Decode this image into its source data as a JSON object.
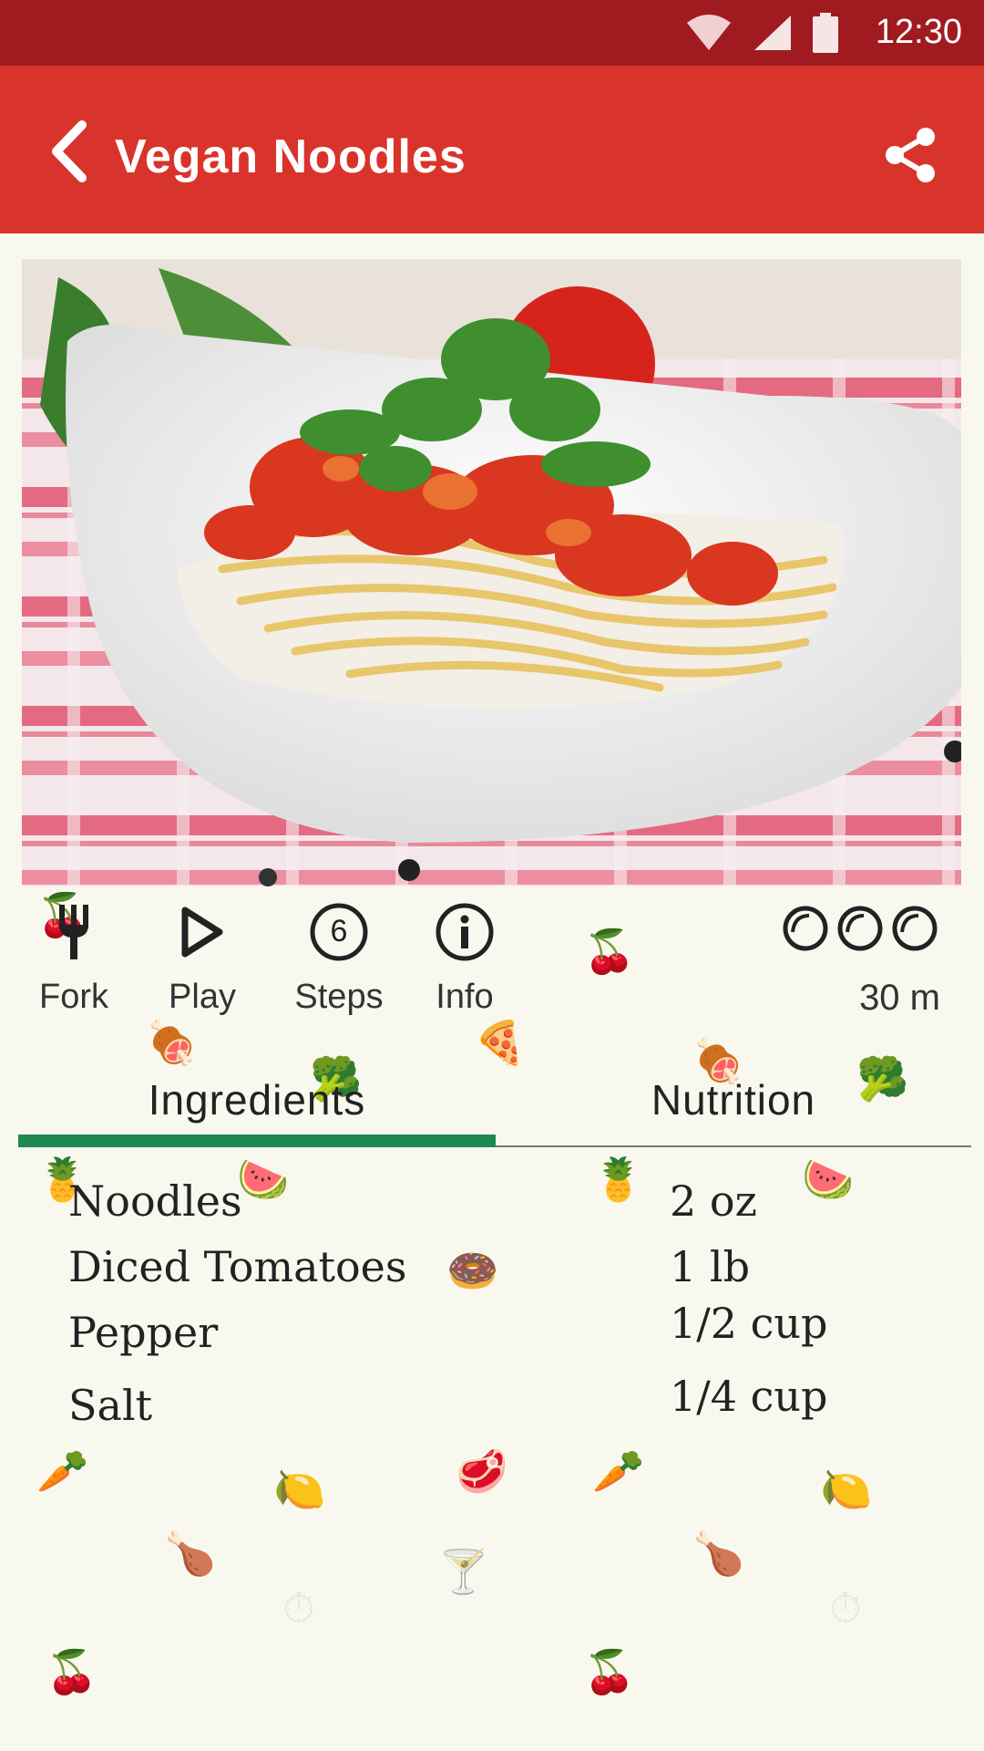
{
  "status_bar": {
    "time": "12:30",
    "wifi_icon": "wifi-icon",
    "signal_icon": "signal-icon",
    "battery_icon": "battery-icon"
  },
  "app_bar": {
    "title": "Vegan Noodles",
    "back_icon": "chevron-left-icon",
    "share_icon": "share-icon",
    "background_color": "#d9342b",
    "status_color": "#a01b20"
  },
  "photo": {
    "icon": "recipe-photo"
  },
  "actions": [
    {
      "label": "Fork",
      "icon": "fork-icon"
    },
    {
      "label": "Play",
      "icon": "play-icon"
    },
    {
      "label": "Steps",
      "icon": "steps-count-icon",
      "badge": "6"
    },
    {
      "label": "Info",
      "icon": "info-icon"
    }
  ],
  "difficulty": {
    "level": 3,
    "max": 3,
    "icon": "difficulty-ring-icon"
  },
  "duration": "30 m",
  "tabs": [
    {
      "label": "Ingredients",
      "selected": true
    },
    {
      "label": "Nutrition",
      "selected": false
    }
  ],
  "accent_color": "#1e8a51",
  "ingredients": [
    {
      "name": "Noodles",
      "quantity": "2 oz"
    },
    {
      "name": "Diced Tomatoes",
      "quantity": "1 lb"
    },
    {
      "name": "Pepper",
      "quantity": "1/2 cup"
    },
    {
      "name": "Salt",
      "quantity": "1/4 cup"
    }
  ]
}
